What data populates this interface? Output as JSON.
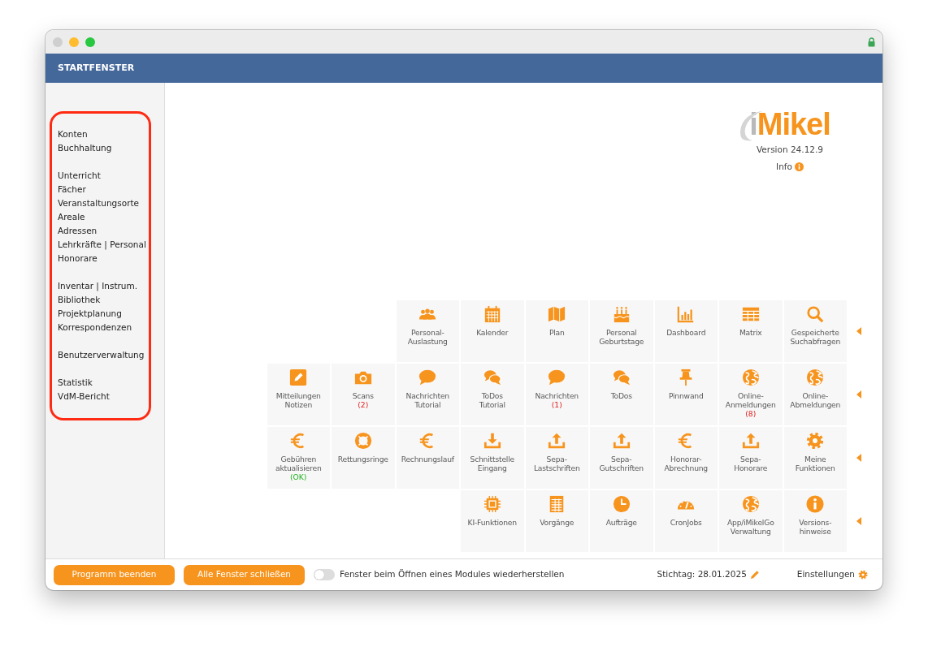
{
  "window": {
    "title": "STARTFENSTER"
  },
  "sidebar": {
    "highlighted": true,
    "groups": [
      {
        "items": [
          "Konten",
          "Buchhaltung"
        ]
      },
      {
        "items": [
          "Unterricht",
          "Fächer",
          "Veranstaltungsorte",
          "Areale",
          "Adressen",
          "Lehrkräfte | Personal",
          "Honorare"
        ]
      },
      {
        "items": [
          "Inventar | Instrum.",
          "Bibliothek",
          "Projektplanung",
          "Korrespondenzen"
        ]
      },
      {
        "items": [
          "Benutzerverwaltung"
        ]
      },
      {
        "items": [
          "Statistik",
          "VdM-Bericht"
        ]
      }
    ]
  },
  "logo": {
    "prefix": "i",
    "main": "Mikel",
    "version": "Version 24.12.9",
    "info": "Info"
  },
  "tile_rows": [
    {
      "tiles": [
        {
          "label": "Personal-\nAuslastung"
        },
        {
          "label": "Kalender"
        },
        {
          "label": "Plan"
        },
        {
          "label": "Personal\nGeburtstage"
        },
        {
          "label": "Dashboard"
        },
        {
          "label": "Matrix"
        },
        {
          "label": "Gespeicherte\nSuchabfragen"
        }
      ]
    },
    {
      "tiles": [
        {
          "label": "Mitteilungen\nNotizen"
        },
        {
          "label": "Scans",
          "badge": {
            "text": "(2)",
            "kind": "alert"
          }
        },
        {
          "label": "Nachrichten\nTutorial"
        },
        {
          "label": "ToDos\nTutorial"
        },
        {
          "label": "Nachrichten",
          "badge": {
            "text": "(1)",
            "kind": "alert"
          }
        },
        {
          "label": "ToDos"
        },
        {
          "label": "Pinnwand"
        },
        {
          "label": "Online-\nAnmeldungen",
          "badge": {
            "text": "(8)",
            "kind": "alert"
          }
        },
        {
          "label": "Online-\nAbmeldungen"
        }
      ]
    },
    {
      "tiles": [
        {
          "label": "Gebühren\naktualisieren",
          "badge": {
            "text": "(OK)",
            "kind": "ok"
          }
        },
        {
          "label": "Rettungsringe"
        },
        {
          "label": "Rechnungslauf"
        },
        {
          "label": "Schnittstelle\nEingang"
        },
        {
          "label": "Sepa-\nLastschriften"
        },
        {
          "label": "Sepa-\nGutschriften"
        },
        {
          "label": "Honorar-\nAbrechnung"
        },
        {
          "label": "Sepa-\nHonorare"
        },
        {
          "label": "Meine\nFunktionen"
        }
      ]
    },
    {
      "tiles": [
        {
          "label": "KI-Funktionen"
        },
        {
          "label": "Vorgänge"
        },
        {
          "label": "Aufträge"
        },
        {
          "label": "CronJobs"
        },
        {
          "label": "App/iMikelGo\nVerwaltung"
        },
        {
          "label": "Versions-\nhinweise"
        }
      ]
    }
  ],
  "footer": {
    "buttons": [
      "Programm beenden",
      "Alle Fenster schließen"
    ],
    "restore_toggle": {
      "label": "Fenster beim Öffnen eines Modules wiederherstellen",
      "on": false
    },
    "reference_date": "Stichtag: 28.01.2025",
    "settings": "Einstellungen"
  }
}
